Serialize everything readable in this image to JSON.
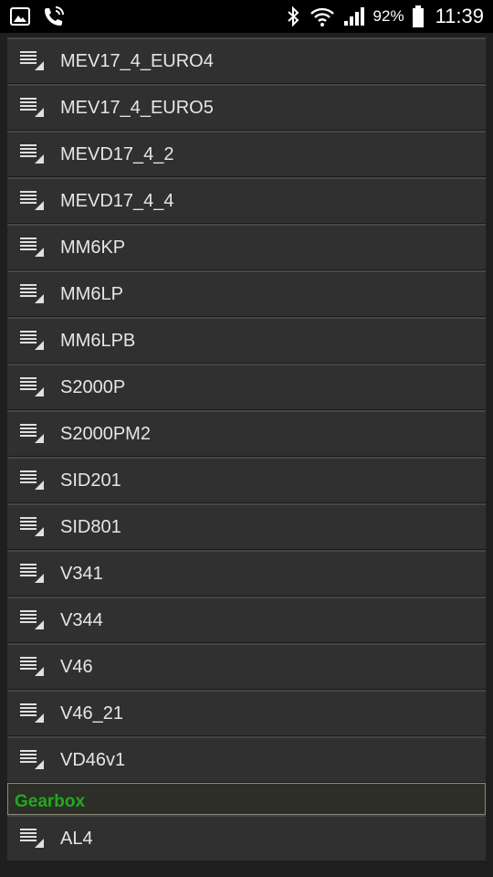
{
  "status_bar": {
    "icons": [
      "gallery-icon",
      "wifi-call-icon",
      "bluetooth-icon",
      "wifi-icon",
      "signal-icon",
      "battery-icon"
    ],
    "battery": "92%",
    "time": "11:39"
  },
  "list": {
    "items_before_section": [
      {
        "label": "MEV17_4_EURO4",
        "icon": "list-menu-icon"
      },
      {
        "label": "MEV17_4_EURO5",
        "icon": "list-menu-icon"
      },
      {
        "label": "MEVD17_4_2",
        "icon": "list-menu-icon"
      },
      {
        "label": "MEVD17_4_4",
        "icon": "list-menu-icon"
      },
      {
        "label": "MM6KP",
        "icon": "list-menu-icon"
      },
      {
        "label": "MM6LP",
        "icon": "list-menu-icon"
      },
      {
        "label": "MM6LPB",
        "icon": "list-menu-icon"
      },
      {
        "label": "S2000P",
        "icon": "list-menu-icon"
      },
      {
        "label": "S2000PM2",
        "icon": "list-menu-icon"
      },
      {
        "label": "SID201",
        "icon": "list-menu-icon"
      },
      {
        "label": "SID801",
        "icon": "list-menu-icon"
      },
      {
        "label": "V341",
        "icon": "list-menu-icon"
      },
      {
        "label": "V344",
        "icon": "list-menu-icon"
      },
      {
        "label": "V46",
        "icon": "list-menu-icon"
      },
      {
        "label": "V46_21",
        "icon": "list-menu-icon"
      },
      {
        "label": "VD46v1",
        "icon": "list-menu-icon"
      }
    ],
    "section": {
      "label": "Gearbox"
    },
    "items_after_section": [
      {
        "label": "AL4",
        "icon": "list-menu-icon"
      }
    ]
  },
  "colors": {
    "section_label": "#1faa1f",
    "item_background": "#303030",
    "status_bar": "#000000"
  }
}
